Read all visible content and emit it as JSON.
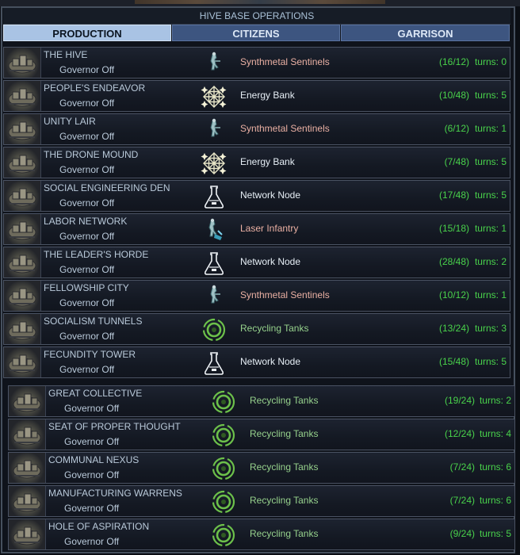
{
  "window": {
    "title": "HIVE BASE OPERATIONS"
  },
  "tabs": [
    {
      "label": "PRODUCTION",
      "active": true
    },
    {
      "label": "CITIZENS",
      "active": false
    },
    {
      "label": "GARRISON",
      "active": false
    }
  ],
  "colors": {
    "progress": "#49d24b",
    "unit_text": "#eab0a3",
    "facility_text": "#e6eef5",
    "project_text": "#96d18c",
    "active_tab": "#a9c3e4",
    "inactive_tab": "#3d5580"
  },
  "bases": [
    {
      "name": "THE HIVE",
      "governor": "Governor Off",
      "production": "Synthmetal Sentinels",
      "icon": "infantry-unit-icon",
      "progress": "(16/12)",
      "turns": "turns: 0"
    },
    {
      "name": "PEOPLE'S ENDEAVOR",
      "governor": "Governor Off",
      "production": "Energy Bank",
      "icon": "energy-bank-icon",
      "progress": "(10/48)",
      "turns": "turns: 5"
    },
    {
      "name": "UNITY LAIR",
      "governor": "Governor Off",
      "production": "Synthmetal Sentinels",
      "icon": "infantry-unit-icon",
      "progress": "(6/12)",
      "turns": "turns: 1"
    },
    {
      "name": "THE DRONE MOUND",
      "governor": "Governor Off",
      "production": "Energy Bank",
      "icon": "energy-bank-icon",
      "progress": "(7/48)",
      "turns": "turns: 5"
    },
    {
      "name": "SOCIAL ENGINEERING DEN",
      "governor": "Governor Off",
      "production": "Network Node",
      "icon": "flask-icon",
      "progress": "(17/48)",
      "turns": "turns: 5"
    },
    {
      "name": "LABOR NETWORK",
      "governor": "Governor Off",
      "production": "Laser Infantry",
      "icon": "laser-infantry-icon",
      "progress": "(15/18)",
      "turns": "turns: 1"
    },
    {
      "name": "THE LEADER'S HORDE",
      "governor": "Governor Off",
      "production": "Network Node",
      "icon": "flask-icon",
      "progress": "(28/48)",
      "turns": "turns: 2"
    },
    {
      "name": "FELLOWSHIP CITY",
      "governor": "Governor Off",
      "production": "Synthmetal Sentinels",
      "icon": "infantry-unit-icon",
      "progress": "(10/12)",
      "turns": "turns: 1"
    },
    {
      "name": "SOCIALISM TUNNELS",
      "governor": "Governor Off",
      "production": "Recycling Tanks",
      "icon": "recycling-tanks-icon",
      "progress": "(13/24)",
      "turns": "turns: 3"
    },
    {
      "name": "FECUNDITY TOWER",
      "governor": "Governor Off",
      "production": "Network Node",
      "icon": "flask-icon",
      "progress": "(15/48)",
      "turns": "turns: 5"
    },
    {
      "name": "GREAT COLLECTIVE",
      "governor": "Governor Off",
      "production": "Recycling Tanks",
      "icon": "recycling-tanks-icon",
      "progress": "(19/24)",
      "turns": "turns: 2"
    },
    {
      "name": "SEAT OF PROPER THOUGHT",
      "governor": "Governor Off",
      "production": "Recycling Tanks",
      "icon": "recycling-tanks-icon",
      "progress": "(12/24)",
      "turns": "turns: 4"
    },
    {
      "name": "COMMUNAL NEXUS",
      "governor": "Governor Off",
      "production": "Recycling Tanks",
      "icon": "recycling-tanks-icon",
      "progress": "(7/24)",
      "turns": "turns: 6"
    },
    {
      "name": "MANUFACTURING WARRENS",
      "governor": "Governor Off",
      "production": "Recycling Tanks",
      "icon": "recycling-tanks-icon",
      "progress": "(7/24)",
      "turns": "turns: 6"
    },
    {
      "name": "HOLE OF ASPIRATION",
      "governor": "Governor Off",
      "production": "Recycling Tanks",
      "icon": "recycling-tanks-icon",
      "progress": "(9/24)",
      "turns": "turns: 5"
    }
  ]
}
